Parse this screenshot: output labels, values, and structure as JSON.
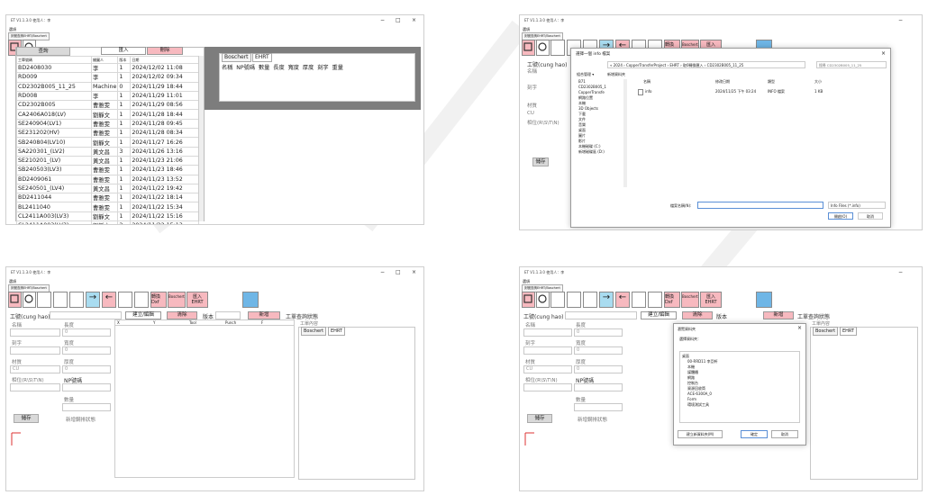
{
  "app": {
    "title": "ET V1.1.3.0 使用人：李",
    "menu": "選項",
    "tabstrip": "刻號查詢EHRT/Boschert",
    "min_glyph": "−",
    "max_glyph": "□",
    "close_glyph": "×"
  },
  "toolbar": {
    "convert_dxf": "轉換 Dxf",
    "boschert": "Boschert",
    "import_ehrt_top": "匯入",
    "import_ehrt_bottom": "EHRT",
    "import_top": "匯入",
    "import_bottom": "匯入"
  },
  "q1": {
    "query_btn": "查詢",
    "import_btn": "匯入",
    "delete_btn": "刪除",
    "columns": [
      "工單號碼",
      "繪圖人",
      "版本",
      "日期"
    ],
    "rows": [
      [
        "BD2408030",
        "李",
        "1",
        "2024/12/02 11:08"
      ],
      [
        "RD009",
        "李",
        "1",
        "2024/12/02 09:34"
      ],
      [
        "CD2302B005_11_25",
        "Machine",
        "0",
        "2024/11/29 18:44"
      ],
      [
        "RD008",
        "李",
        "1",
        "2024/11/29 11:01"
      ],
      [
        "CD2302B005",
        "曹雅雯",
        "1",
        "2024/11/29 08:56"
      ],
      [
        "CA2406A018(LV)",
        "劉靜文",
        "1",
        "2024/11/28 18:44"
      ],
      [
        "SE240904(LV1)",
        "曹雅雯",
        "1",
        "2024/11/28 09:45"
      ],
      [
        "SE231202(HV)",
        "曹雅雯",
        "1",
        "2024/11/28 08:34"
      ],
      [
        "SB240804(LV10)",
        "劉靜文",
        "1",
        "2024/11/27 16:26"
      ],
      [
        "SA220301_(LV2)",
        "黃文昌",
        "3",
        "2024/11/26 13:16"
      ],
      [
        "SE210201_(LV)",
        "黃文昌",
        "1",
        "2024/11/23 21:06"
      ],
      [
        "SB240503(LV3)",
        "曹雅雯",
        "1",
        "2024/11/23 18:46"
      ],
      [
        "BD2409061",
        "曹雅雯",
        "1",
        "2024/11/23 13:52"
      ],
      [
        "SE240501_(LV4)",
        "黃文昌",
        "1",
        "2024/11/22 19:42"
      ],
      [
        "BD2411044",
        "曹雅雯",
        "1",
        "2024/11/22 18:14"
      ],
      [
        "BL2411040",
        "曹雅雯",
        "1",
        "2024/11/22 15:34"
      ],
      [
        "CL2411A003(LV3)",
        "劉靜文",
        "1",
        "2024/11/22 15:16"
      ],
      [
        "CL2411A003(LV3)",
        "劉靜文",
        "2",
        "2024/11/22 15:13"
      ],
      [
        "BC2411095",
        "曹雅雯",
        "1",
        "2024/11/22 15:12"
      ]
    ],
    "tab_boschert": "Boschert",
    "tab_ehrt": "EHRT",
    "detail_cols": "名稱  NP號碼  數量  長度  寬度  厚度  刻字  重量",
    "side_hint": "工單查詢狀態"
  },
  "q2": {
    "dialog_title": "選擇一個 info 檔案",
    "path": "« 2024 › CopperTransferProject › EHRT › 取0轉換匯入 › CD2302B005_11_25",
    "search": "搜尋 CD2302B005_11_25",
    "organize": "組合管理 ▾",
    "new_folder": "新增資料夾",
    "nav_items": [
      "B71",
      "CD2302B005_1",
      "CopperTransfe",
      "網路位置",
      "本機",
      "3D Objects",
      "下載",
      "文件",
      "音樂",
      "桌面",
      "圖片",
      "影片",
      "本機磁碟 (C:)",
      "新增磁碟區 (D:)"
    ],
    "col_name": "名稱",
    "col_date": "修改日期",
    "col_type": "類型",
    "col_size": "大小",
    "file_name": "info",
    "file_date": "2024/11/25 下午 03:24",
    "file_type": "INFO 檔案",
    "file_size": "1 KB",
    "filename_label": "檔案名稱(N):",
    "filter": "Info Files (*.info)",
    "open_btn": "開啟(O)",
    "cancel_btn": "取消",
    "bg_labels": [
      "工號(cung hao)",
      "名稱",
      "刻字",
      "材質",
      "CU",
      "相位(R\\S\\T\\N)",
      "儲存"
    ]
  },
  "q3": {
    "gonghao": "工號(cung hao)",
    "build_btn": "建立/編輯",
    "clear_btn": "清除",
    "version": "版本",
    "add_btn": "新增",
    "query_status": "工單查詢狀態",
    "name": "名稱",
    "length": "長度",
    "zero": "0",
    "engrave": "刻字",
    "width": "寬度",
    "material": "材質",
    "thickness": "厚度",
    "cu": "CU",
    "phase": "相位(R\\S\\T\\N)",
    "np": "NP號碼",
    "qty": "數量",
    "save_btn": "儲存",
    "status_text": "新增鋼排狀態",
    "grid_cols": [
      "X",
      "Y",
      "Tool",
      "Punch",
      "F"
    ],
    "order_content": "工單內容",
    "tab_boschert": "Boschert",
    "tab_ehrt": "EHRT"
  },
  "q4": {
    "dialog_title": "瀏覽資料夾",
    "prompt": "選擇資料夾：",
    "tree": [
      "桌面",
      "00-RRD11 李亞軒",
      "本機",
      "媒體櫃",
      "網路",
      "控制台",
      "資源回收筒",
      "ACE-6300A_0",
      "Form",
      "環境測試工具"
    ],
    "new_folder_btn": "建立新資料夾(M)",
    "ok_btn": "確定",
    "cancel_btn": "取消",
    "order_content": "工單內容",
    "tab_boschert": "Boschert",
    "tab_ehrt": "EHRT"
  },
  "colors": {
    "pink": "#f7b9bf",
    "blue": "#a9dcf0",
    "grey_btn": "#d9d9d9"
  }
}
